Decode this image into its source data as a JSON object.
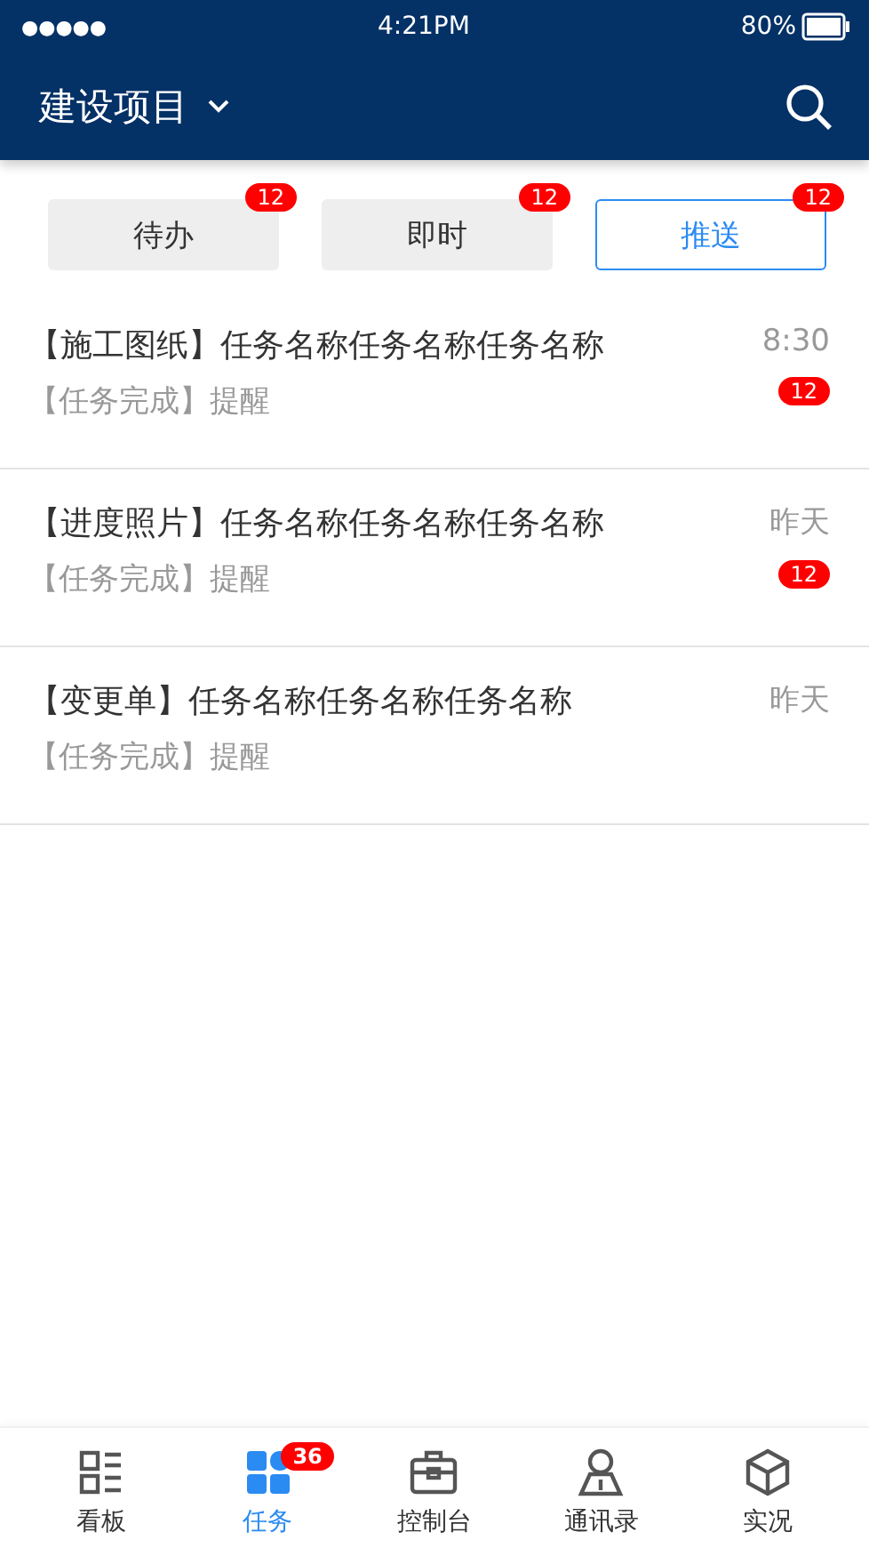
{
  "status_bar": {
    "signal": "●●●●●",
    "time": "4:21PM",
    "battery": "80%"
  },
  "header": {
    "title": "建设项目"
  },
  "tabs": [
    {
      "label": "待办",
      "badge": "12",
      "selected": false
    },
    {
      "label": "即时",
      "badge": "12",
      "selected": false
    },
    {
      "label": "推送",
      "badge": "12",
      "selected": true
    }
  ],
  "rows": [
    {
      "title": "【施工图纸】任务名称任务名称任务名称",
      "subtitle": "【任务完成】提醒",
      "time": "8:30",
      "badge": "12"
    },
    {
      "title": "【进度照片】任务名称任务名称任务名称",
      "subtitle": "【任务完成】提醒",
      "time": "昨天",
      "badge": "12"
    },
    {
      "title": "【变更单】任务名称任务名称任务名称",
      "subtitle": "【任务完成】提醒",
      "time": "昨天"
    }
  ],
  "nav": [
    {
      "kind": "board",
      "label": "看板",
      "selected": false
    },
    {
      "kind": "task",
      "label": "任务",
      "selected": true,
      "badge": "36"
    },
    {
      "kind": "console",
      "label": "控制台",
      "selected": false
    },
    {
      "kind": "contacts",
      "label": "通讯录",
      "selected": false
    },
    {
      "kind": "cube",
      "label": "实况",
      "selected": false
    }
  ]
}
